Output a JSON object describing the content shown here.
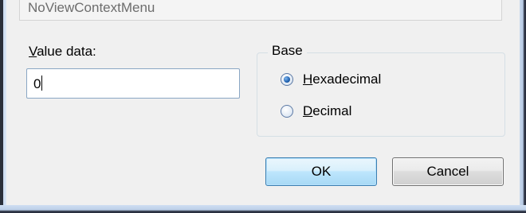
{
  "value_name": "NoViewContextMenu",
  "value_data": {
    "label_prefix": "V",
    "label_rest": "alue data:",
    "value": "0"
  },
  "base": {
    "legend": "Base",
    "options": [
      {
        "label_prefix": "H",
        "label_rest": "exadecimal",
        "selected": true
      },
      {
        "label_prefix": "D",
        "label_rest": "ecimal",
        "selected": false
      }
    ]
  },
  "buttons": {
    "ok": "OK",
    "cancel": "Cancel"
  },
  "colors": {
    "dialog_bg": "#f0f0f0",
    "default_button_border": "#3c7fb1",
    "radio_dot": "#1d5fae"
  }
}
